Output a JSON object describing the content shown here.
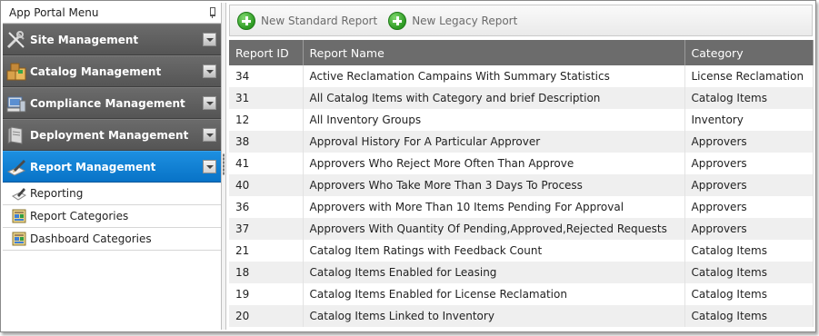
{
  "sidebar": {
    "title": "App Portal Menu",
    "groups": [
      {
        "label": "Site Management",
        "icon": "wrench-screwdriver-icon",
        "active": false
      },
      {
        "label": "Catalog Management",
        "icon": "boxes-icon",
        "active": false
      },
      {
        "label": "Compliance Management",
        "icon": "computer-icon",
        "active": false
      },
      {
        "label": "Deployment Management",
        "icon": "server-icon",
        "active": false
      },
      {
        "label": "Report Management",
        "icon": "report-pen-icon",
        "active": true
      }
    ],
    "sub_items": [
      {
        "label": "Reporting",
        "icon": "report-pen-icon"
      },
      {
        "label": "Report Categories",
        "icon": "grid-category-icon"
      },
      {
        "label": "Dashboard Categories",
        "icon": "grid-category-icon"
      }
    ]
  },
  "toolbar": {
    "new_standard_label": "New Standard Report",
    "new_legacy_label": "New Legacy Report"
  },
  "table": {
    "headers": [
      "Report ID",
      "Report Name",
      "Category"
    ],
    "rows": [
      [
        "34",
        "Active Reclamation Campains With Summary Statistics",
        "License Reclamation"
      ],
      [
        "31",
        "All Catalog Items with Category and brief Description",
        "Catalog Items"
      ],
      [
        "12",
        "All Inventory Groups",
        "Inventory"
      ],
      [
        "38",
        "Approval History For A Particular Approver",
        "Approvers"
      ],
      [
        "41",
        "Approvers Who Reject More Often Than Approve",
        "Approvers"
      ],
      [
        "40",
        "Approvers Who Take More Than 3 Days To Process",
        "Approvers"
      ],
      [
        "36",
        "Approvers with More Than 10 Items Pending For Approval",
        "Approvers"
      ],
      [
        "37",
        "Approvers With Quantity Of Pending,Approved,Rejected Requests",
        "Approvers"
      ],
      [
        "21",
        "Catalog Item Ratings with Feedback Count",
        "Catalog Items"
      ],
      [
        "18",
        "Catalog Items Enabled for Leasing",
        "Catalog Items"
      ],
      [
        "19",
        "Catalog Items Enabled for License Reclamation",
        "Catalog Items"
      ],
      [
        "20",
        "Catalog Items Linked to Inventory",
        "Catalog Items"
      ]
    ]
  }
}
